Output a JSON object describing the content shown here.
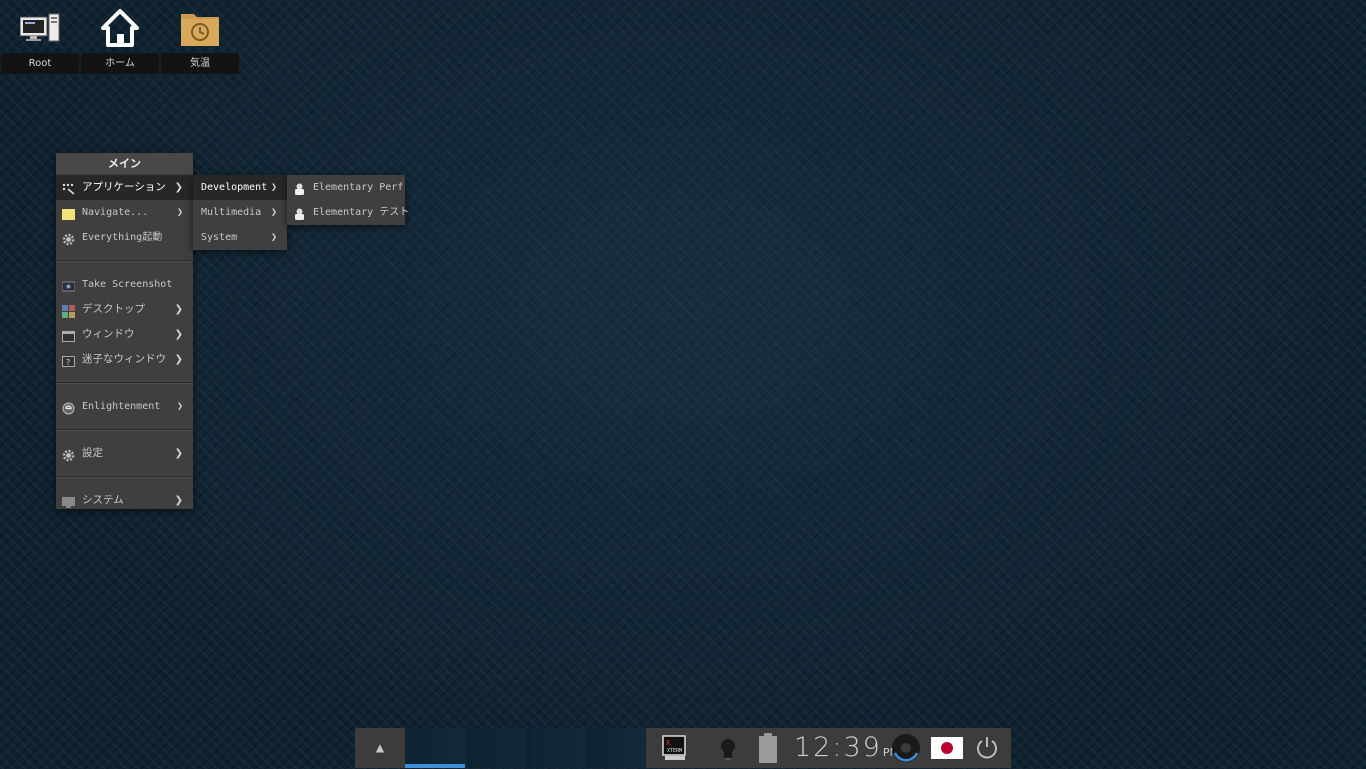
{
  "desktop": {
    "icons": [
      {
        "label": "Root",
        "icon": "computer-icon"
      },
      {
        "label": "ホーム",
        "icon": "home-icon"
      },
      {
        "label": "気温",
        "icon": "folder-clock-icon"
      }
    ]
  },
  "main_menu": {
    "title": "メイン",
    "items": [
      {
        "label": "アプリケーション",
        "icon": "applications-icon"
      },
      {
        "label": "Navigate...",
        "icon": "folder-icon"
      },
      {
        "label": "Everything起動",
        "icon": "gear-icon"
      },
      {
        "label": "Take Screenshot",
        "icon": "screenshot-icon"
      },
      {
        "label": "デスクトップ",
        "icon": "desktop-icon"
      },
      {
        "label": "ウィンドウ",
        "icon": "window-icon"
      },
      {
        "label": "迷子なウィンドウ",
        "icon": "lost-window-icon"
      },
      {
        "label": "Enlightenment",
        "icon": "enlightenment-icon"
      },
      {
        "label": "設定",
        "icon": "gear-icon"
      },
      {
        "label": "システム",
        "icon": "system-icon"
      }
    ]
  },
  "applications_menu": {
    "items": [
      {
        "label": "Development"
      },
      {
        "label": "Multimedia"
      },
      {
        "label": "System"
      }
    ]
  },
  "development_menu": {
    "items": [
      {
        "label": "Elementary Perf",
        "icon": "elementary-icon"
      },
      {
        "label": "Elementary テスト",
        "icon": "elementary-icon"
      }
    ]
  },
  "shelf": {
    "clock": {
      "time": "12:39",
      "ampm": "PM"
    },
    "xterm_label": "XTERM",
    "colors": {
      "accent": "#3d8fd8",
      "flag_red": "#bc002d"
    }
  }
}
